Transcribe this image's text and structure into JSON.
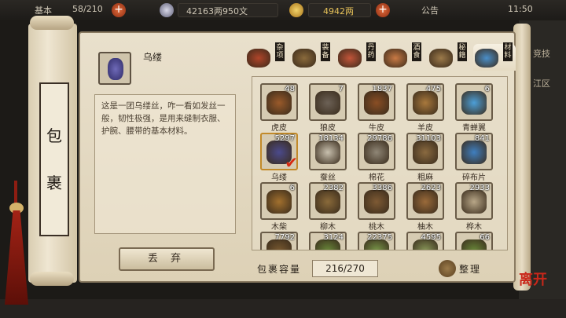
{
  "topbar": {
    "left_text": "基本",
    "energy": "58/210",
    "silver": "42163两950文",
    "gold": "4942两",
    "notice": "公告",
    "time": "11:50"
  },
  "side_labels": [
    "竞技",
    "江区"
  ],
  "leave_label": "离开",
  "title_chars": [
    "包",
    "裹"
  ],
  "selected_item": {
    "name": "乌缕",
    "description": "这是一团乌缕丝，咋一看如发丝一般，韧性极强，是用来缝制衣服、护腕、腰带的基本材料。"
  },
  "drop_button": "丢 弃",
  "tabs": [
    {
      "label": "杂项",
      "color": "#b0452a"
    },
    {
      "label": "装备",
      "color": "#8a6a3c"
    },
    {
      "label": "丹药",
      "color": "#c2553a"
    },
    {
      "label": "酒食",
      "color": "#c97a45"
    },
    {
      "label": "秘籍",
      "color": "#9c7a4a"
    },
    {
      "label": "材料",
      "color": "#4a8fc9"
    }
  ],
  "items": [
    {
      "name": "虎皮",
      "count": "48",
      "color": "#9a5a2a"
    },
    {
      "name": "狼皮",
      "count": "7",
      "color": "#6c6156"
    },
    {
      "name": "牛皮",
      "count": "1837",
      "color": "#8a4e24"
    },
    {
      "name": "羊皮",
      "count": "475",
      "color": "#a8783c"
    },
    {
      "name": "青蝉翼",
      "count": "6",
      "color": "#4c9fd8"
    },
    {
      "name": "乌缕",
      "count": "5297",
      "color": "#4b4a8c",
      "selected": true
    },
    {
      "name": "蚕丝",
      "count": "18134",
      "color": "#c8c0ae"
    },
    {
      "name": "棉花",
      "count": "29786",
      "color": "#8f8676"
    },
    {
      "name": "粗麻",
      "count": "31103",
      "color": "#8a6a40"
    },
    {
      "name": "碎布片",
      "count": "841",
      "color": "#3f7fc0"
    },
    {
      "name": "木柴",
      "count": "6",
      "color": "#a2702e"
    },
    {
      "name": "柳木",
      "count": "2382",
      "color": "#8a6a3a"
    },
    {
      "name": "桃木",
      "count": "3386",
      "color": "#7e5a34"
    },
    {
      "name": "柚木",
      "count": "2623",
      "color": "#9a6a3a"
    },
    {
      "name": "桦木",
      "count": "2933",
      "color": "#b8a788"
    },
    {
      "name": "",
      "count": "7792",
      "color": "#7a5a30"
    },
    {
      "name": "",
      "count": "3124",
      "color": "#6a8a3a"
    },
    {
      "name": "",
      "count": "22375",
      "color": "#7a9a4a"
    },
    {
      "name": "",
      "count": "4595",
      "color": "#8a9a5a"
    },
    {
      "name": "",
      "count": "66",
      "color": "#6a8a3a"
    }
  ],
  "capacity": {
    "label": "包裹容量",
    "value": "216/270"
  },
  "sort_label": "整理"
}
